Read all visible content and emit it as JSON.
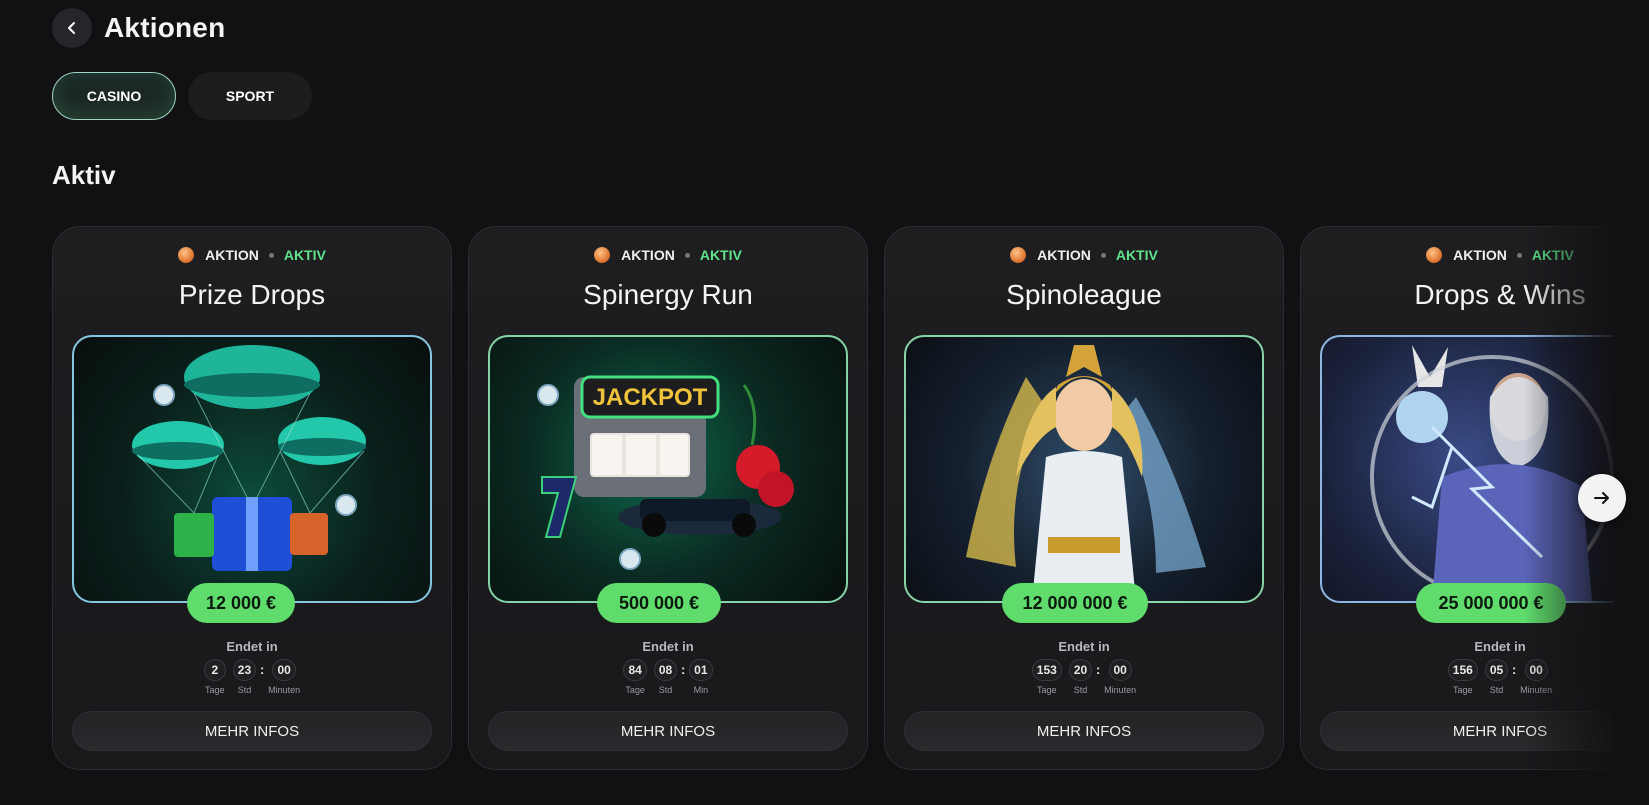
{
  "header": {
    "title": "Aktionen"
  },
  "tabs": [
    {
      "label": "CASINO",
      "active": true
    },
    {
      "label": "SPORT",
      "active": false
    }
  ],
  "section": {
    "title": "Aktiv"
  },
  "countdown_label": "Endet in",
  "colors": {
    "accent_green": "#5fdc6c",
    "status_green": "#5ee38a",
    "background": "#111113"
  },
  "cards": [
    {
      "meta_label": "AKTION",
      "status": "AKTIV",
      "title": "Prize Drops",
      "image": "prize-drops-parachute-gifts-illustration",
      "prize": "12 000 €",
      "countdown": [
        {
          "value": "2",
          "unit": "Tage"
        },
        {
          "value": "23",
          "unit": "Std"
        },
        {
          "value": "00",
          "unit": "Minuten"
        }
      ],
      "button": "MEHR INFOS"
    },
    {
      "meta_label": "AKTION",
      "status": "AKTIV",
      "title": "Spinergy Run",
      "image": "jackpot-slot-machine-racecar-illustration",
      "prize": "500 000 €",
      "countdown": [
        {
          "value": "84",
          "unit": "Tage"
        },
        {
          "value": "08",
          "unit": "Std"
        },
        {
          "value": "01",
          "unit": "Min"
        }
      ],
      "button": "MEHR INFOS"
    },
    {
      "meta_label": "AKTION",
      "status": "AKTIV",
      "title": "Spinoleague",
      "image": "golden-goddess-illustration",
      "prize": "12 000 000 €",
      "countdown": [
        {
          "value": "153",
          "unit": "Tage"
        },
        {
          "value": "20",
          "unit": "Std"
        },
        {
          "value": "00",
          "unit": "Minuten"
        }
      ],
      "button": "MEHR INFOS"
    },
    {
      "meta_label": "AKTION",
      "status": "AKTIV",
      "title": "Drops & Wins",
      "image": "zeus-lightning-illustration",
      "prize": "25 000 000 €",
      "countdown": [
        {
          "value": "156",
          "unit": "Tage"
        },
        {
          "value": "05",
          "unit": "Std"
        },
        {
          "value": "00",
          "unit": "Minuten"
        }
      ],
      "button": "MEHR INFOS"
    }
  ],
  "icons": {
    "back": "chevron-left-icon",
    "next": "arrow-right-icon",
    "coin": "coin-icon"
  }
}
